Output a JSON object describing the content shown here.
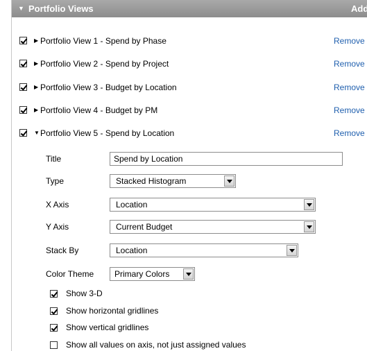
{
  "panel": {
    "title": "Portfolio Views",
    "add_label": "Add"
  },
  "views": [
    {
      "checked": true,
      "label": "Portfolio View 1 - Spend by Phase",
      "remove_label": "Remove",
      "expanded": false
    },
    {
      "checked": true,
      "label": "Portfolio View 2 - Spend by Project",
      "remove_label": "Remove",
      "expanded": false
    },
    {
      "checked": true,
      "label": "Portfolio View 3 - Budget by Location",
      "remove_label": "Remove",
      "expanded": false
    },
    {
      "checked": true,
      "label": "Portfolio View 4 - Budget by PM",
      "remove_label": "Remove",
      "expanded": false
    },
    {
      "checked": true,
      "label": "Portfolio View 5 - Spend by Location",
      "remove_label": "Remove",
      "expanded": true
    }
  ],
  "detail": {
    "title_label": "Title",
    "title_value": "Spend by Location",
    "type_label": "Type",
    "type_value": "Stacked Histogram",
    "x_axis_label": "X Axis",
    "x_axis_value": "Location",
    "y_axis_label": "Y Axis",
    "y_axis_value": "Current Budget",
    "stack_by_label": "Stack By",
    "stack_by_value": "Location",
    "color_theme_label": "Color Theme",
    "color_theme_value": "Primary Colors"
  },
  "options": [
    {
      "label": "Show 3-D",
      "checked": true
    },
    {
      "label": "Show horizontal gridlines",
      "checked": true
    },
    {
      "label": "Show vertical gridlines",
      "checked": true
    },
    {
      "label": "Show all values on axis, not just assigned values",
      "checked": false
    }
  ],
  "colors": {
    "header_bg": "#9a9a9a",
    "link": "#1f5fae"
  },
  "icons": {
    "collapsed": "triangle-right-icon",
    "expanded": "triangle-down-icon"
  }
}
